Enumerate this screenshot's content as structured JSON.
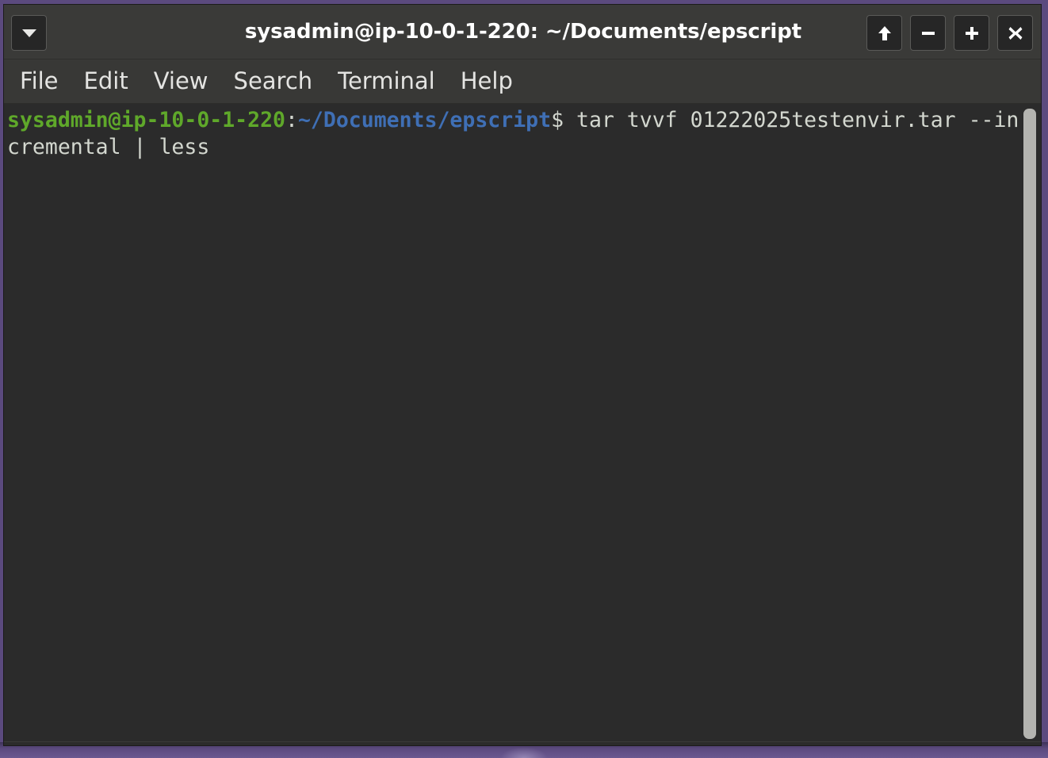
{
  "window": {
    "title": "sysadmin@ip-10-0-1-220: ~/Documents/epscript",
    "menu_toggle_icon": "chevron-down-icon",
    "controls": [
      {
        "name": "shade-button",
        "icon": "arrow-up-icon",
        "label": "↑"
      },
      {
        "name": "minimize-button",
        "icon": "minus-icon",
        "label": "−"
      },
      {
        "name": "maximize-button",
        "icon": "plus-icon",
        "label": "+"
      },
      {
        "name": "close-button",
        "icon": "close-icon",
        "label": "✕"
      }
    ]
  },
  "menubar": {
    "items": [
      {
        "label": "File"
      },
      {
        "label": "Edit"
      },
      {
        "label": "View"
      },
      {
        "label": "Search"
      },
      {
        "label": "Terminal"
      },
      {
        "label": "Help"
      }
    ]
  },
  "terminal": {
    "prompt": {
      "user_host": "sysadmin@ip-10-0-1-220",
      "separator": ":",
      "path": "~/Documents/epscript",
      "sigil": "$ "
    },
    "command": "tar tvvf 01222025testenvir.tar --incremental | less",
    "output": "",
    "scrollbar": {
      "name": "vertical-scrollbar"
    }
  },
  "colors": {
    "titlebar_bg": "#3a3a38",
    "menubar_bg": "#383836",
    "terminal_bg": "#2b2b2b",
    "prompt_green": "#5fa82a",
    "prompt_blue": "#3f6fb5",
    "text_fg": "#d3d7cf",
    "desktop_purple": "#5b4a7e",
    "scrollbar_thumb": "#b4b4b0"
  }
}
